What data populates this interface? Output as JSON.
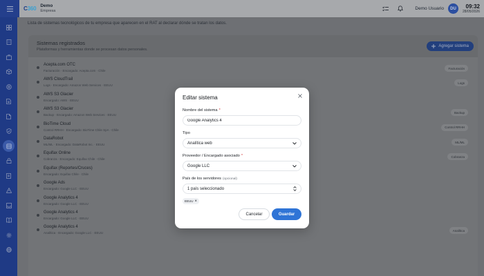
{
  "header": {
    "logo_main": "C",
    "logo_accent": "360",
    "org_name": "Demo",
    "org_sub": "Empresa",
    "user_name": "Demo Usuario",
    "user_initials": "DU",
    "time": "09:32",
    "date": "28/05/2026"
  },
  "sidebar": {
    "items": [
      "grid-icon",
      "building-icon",
      "briefcase-icon",
      "box-icon",
      "shield-icon",
      "document-icon",
      "file-icon",
      "shield-check-icon",
      "database-icon",
      "lock-icon",
      "file-text-icon",
      "warning-icon",
      "inbox-icon",
      "book-icon",
      "settings-icon",
      "globe-icon"
    ],
    "active_index": 8
  },
  "page": {
    "description": "Lista de sistemas tecnológicos de tu empresa que aparecen en el RAT al declarar dónde se tratan los datos."
  },
  "card": {
    "title": "Sistemas registrados",
    "subtitle": "Plataformas y herramientas donde se procesan datos personales.",
    "add_label": "Agregar sistema",
    "rows": [
      {
        "name": "Acepta.com OTC",
        "meta": "Facturación · Encargado: Acepta.com · Chile",
        "tag": "Facturación"
      },
      {
        "name": "AWS CloudTrail",
        "meta": "Logs · Encargado: Amazon Web Services · EEUU",
        "tag": "Logs"
      },
      {
        "name": "AWS S3 Glacier",
        "meta": "Encargado: AWS · EEUU",
        "tag": ""
      },
      {
        "name": "AWS S3 Glacier",
        "meta": "Backup · Encargado: Amazon Web Services · EEUU",
        "tag": "Backup"
      },
      {
        "name": "BioTime Cloud",
        "meta": "Control RRHH · Encargado: BioTime Chile SpA · Chile",
        "tag": "Control RRHH"
      },
      {
        "name": "DataRobot",
        "meta": "ML/ML · Encargado: DataRobot Inc. · EEUU",
        "tag": "ML/ML"
      },
      {
        "name": "Equifax Online",
        "meta": "Cobranza · Encargado: Equifax Chile · Chile",
        "tag": "Cobranza"
      },
      {
        "name": "Equifax (Reportes/Cruces)",
        "meta": "Encargado: Equifax Chile · Chile",
        "tag": ""
      },
      {
        "name": "Google Ads",
        "meta": "Encargado: Google LLC · EEUU",
        "tag": ""
      },
      {
        "name": "Google Analytics 4",
        "meta": "Encargado: Google LLC · EEUU",
        "tag": ""
      },
      {
        "name": "Google Analytics 4",
        "meta": "Encargado: Google LLC · EEUU",
        "tag": ""
      },
      {
        "name": "Google Analytics 4",
        "meta": "Analítica · Encargado: Google LLC · EEUU",
        "tag": "Analítica"
      }
    ]
  },
  "modal": {
    "title": "Editar sistema",
    "name_label": "Nombre del sistema",
    "name_value": "Google Analytics 4",
    "type_label": "Tipo",
    "type_value": "Analítica web",
    "provider_label": "Proveedor / Encargado asociado",
    "provider_value": "Google LLC",
    "country_label": "País de los servidores",
    "country_optional": "(opcional)",
    "country_value": "1 país seleccionado",
    "chip": "EEUU",
    "required_mark": "*",
    "cancel_label": "Cancelar",
    "save_label": "Guardar"
  },
  "colors": {
    "primary": "#2f74d6",
    "sidebar": "#1f3a85",
    "required": "#d64545"
  }
}
